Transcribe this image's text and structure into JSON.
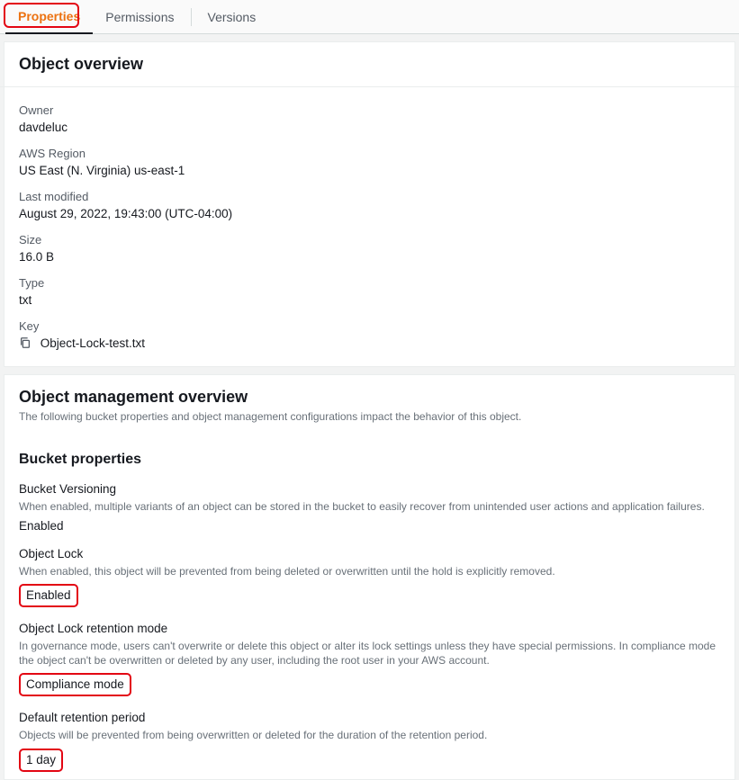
{
  "tabs": {
    "properties": "Properties",
    "permissions": "Permissions",
    "versions": "Versions"
  },
  "overview": {
    "title": "Object overview",
    "owner_label": "Owner",
    "owner_value": "davdeluc",
    "region_label": "AWS Region",
    "region_value": "US East (N. Virginia) us-east-1",
    "modified_label": "Last modified",
    "modified_value": "August 29, 2022, 19:43:00 (UTC-04:00)",
    "size_label": "Size",
    "size_value": "16.0 B",
    "type_label": "Type",
    "type_value": "txt",
    "key_label": "Key",
    "key_value": "Object-Lock-test.txt"
  },
  "mgmt": {
    "title": "Object management overview",
    "subtitle": "The following bucket properties and object management configurations impact the behavior of this object.",
    "bucket_props_title": "Bucket properties",
    "versioning": {
      "title": "Bucket Versioning",
      "desc": "When enabled, multiple variants of an object can be stored in the bucket to easily recover from unintended user actions and application failures.",
      "value": "Enabled"
    },
    "object_lock": {
      "title": "Object Lock",
      "desc": "When enabled, this object will be prevented from being deleted or overwritten until the hold is explicitly removed.",
      "value": "Enabled"
    },
    "retention_mode": {
      "title": "Object Lock retention mode",
      "desc": "In governance mode, users can't overwrite or delete this object or alter its lock settings unless they have special permissions. In compliance mode the object can't be overwritten or deleted by any user, including the root user in your AWS account.",
      "value": "Compliance mode"
    },
    "retention_period": {
      "title": "Default retention period",
      "desc": "Objects will be prevented from being overwritten or deleted for the duration of the retention period.",
      "value": "1 day"
    }
  }
}
